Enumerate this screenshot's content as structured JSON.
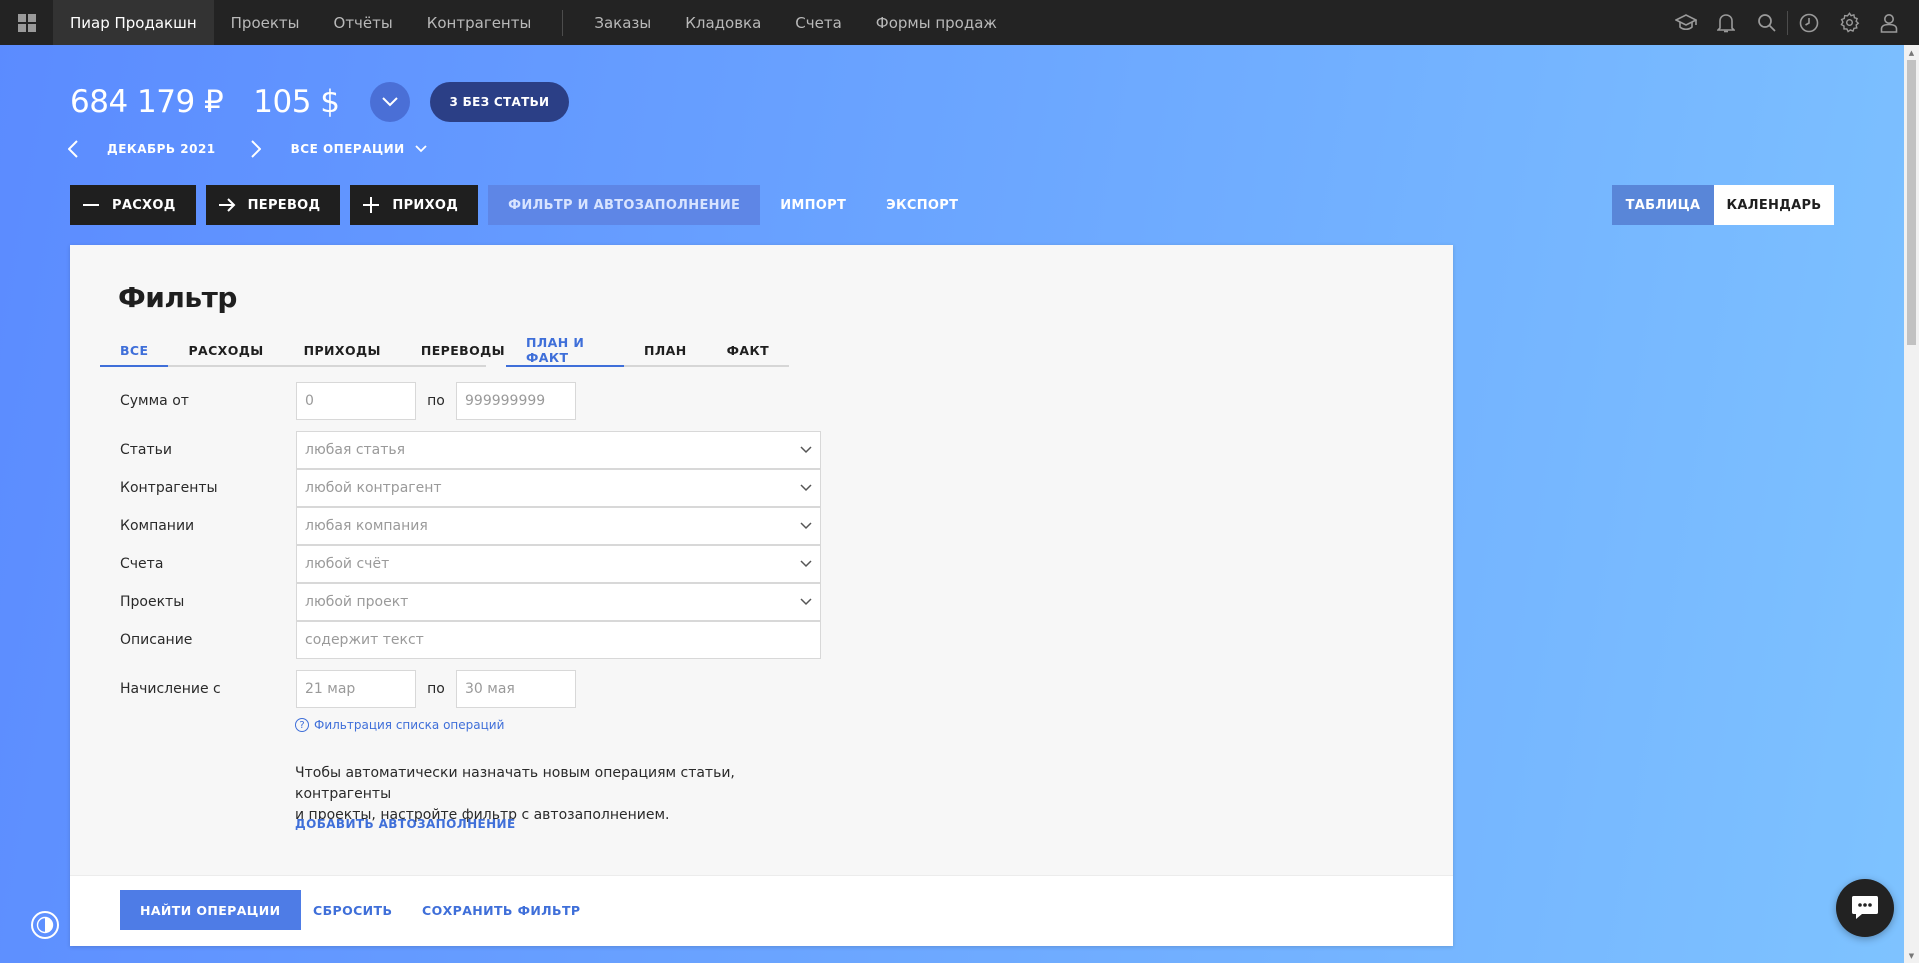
{
  "topbar": {
    "company": "Пиар Продакшн",
    "nav": [
      "Проекты",
      "Отчёты",
      "Контрагенты"
    ],
    "nav2": [
      "Заказы",
      "Кладовка",
      "Счета",
      "Формы продаж"
    ]
  },
  "balance": {
    "rub": "684 179 ₽",
    "usd": "105 $",
    "uncategorized": "3 БЕЗ СТАТЬИ"
  },
  "period": {
    "label": "ДЕКАБРЬ 2021",
    "operations": "ВСЕ ОПЕРАЦИИ"
  },
  "actions": {
    "expense": "РАСХОД",
    "transfer": "ПЕРЕВОД",
    "income": "ПРИХОД",
    "filter": "ФИЛЬТР И АВТОЗАПОЛНЕНИЕ",
    "import": "ИМПОРТ",
    "export": "ЭКСПОРТ"
  },
  "view": {
    "table": "ТАБЛИЦА",
    "calendar": "КАЛЕНДАРЬ"
  },
  "filter": {
    "title": "Фильтр",
    "type_tabs": [
      "ВСЕ",
      "РАСХОДЫ",
      "ПРИХОДЫ",
      "ПЕРЕВОДЫ"
    ],
    "plan_tabs": [
      "ПЛАН И ФАКТ",
      "ПЛАН",
      "ФАКТ"
    ],
    "sum_label": "Сумма от",
    "sum_from_placeholder": "0",
    "sum_to_placeholder": "999999999",
    "to_label": "по",
    "articles_label": "Статьи",
    "articles_placeholder": "любая статья",
    "contractors_label": "Контрагенты",
    "contractors_placeholder": "любой контрагент",
    "companies_label": "Компании",
    "companies_placeholder": "любая компания",
    "accounts_label": "Счета",
    "accounts_placeholder": "любой счёт",
    "projects_label": "Проекты",
    "projects_placeholder": "любой проект",
    "description_label": "Описание",
    "description_placeholder": "содержит текст",
    "accrual_label": "Начисление с",
    "accrual_from_placeholder": "21 мар",
    "accrual_to_placeholder": "30 мая",
    "help_link": "Фильтрация списка операций",
    "note_line1": "Чтобы автоматически назначать новым операциям статьи, контрагенты",
    "note_line2": "и проекты, настройте фильтр с автозаполнением.",
    "add_autofill": "ДОБАВИТЬ АВТОЗАПОЛНЕНИЕ",
    "find_button": "НАЙТИ ОПЕРАЦИИ",
    "reset_button": "СБРОСИТЬ",
    "save_button": "СОХРАНИТЬ ФИЛЬТР"
  }
}
